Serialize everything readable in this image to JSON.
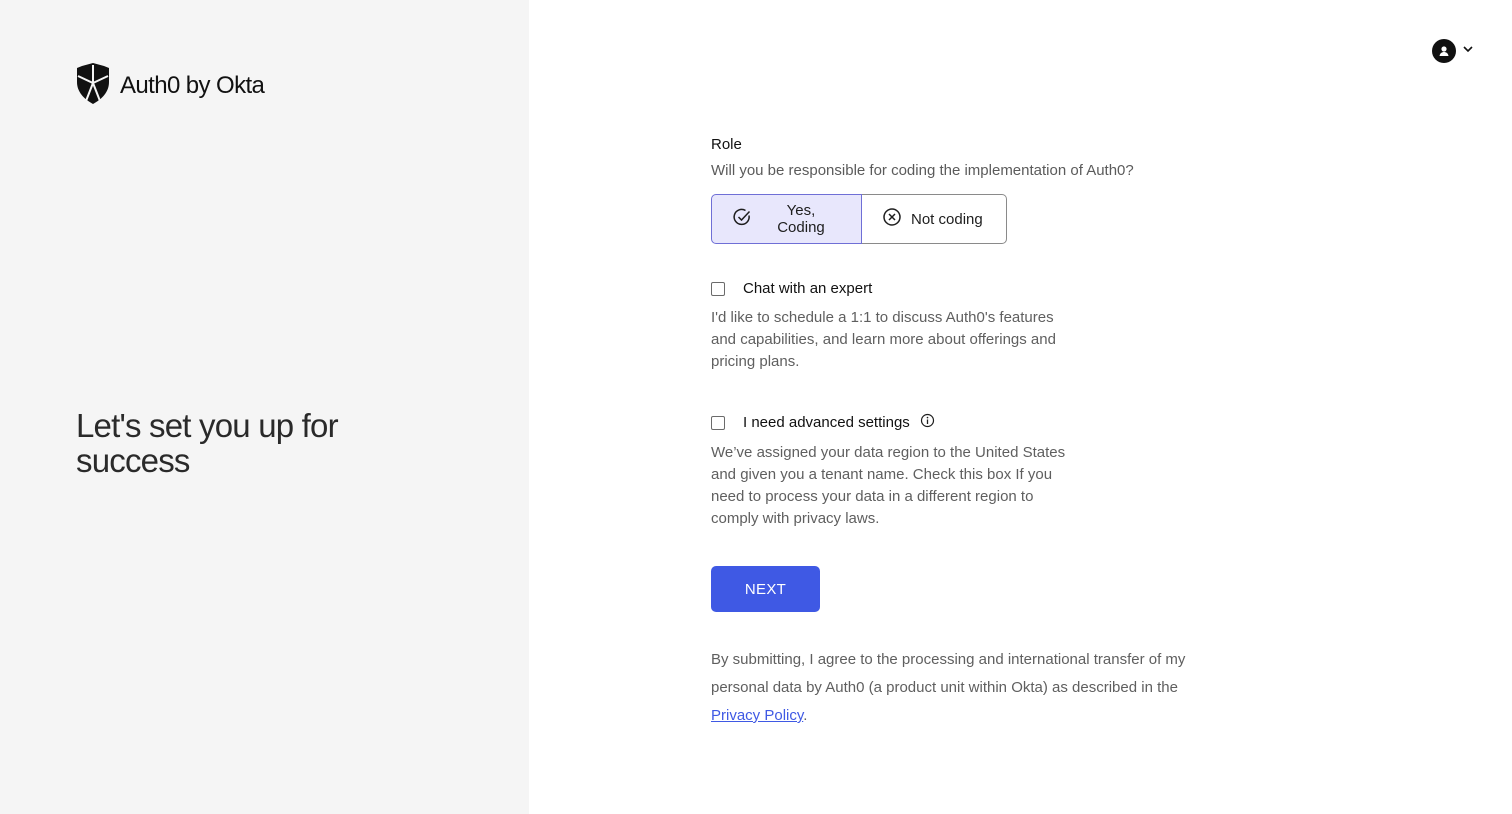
{
  "brand": {
    "name": "Auth0 by Okta",
    "logo_icon": "auth0-shield-icon"
  },
  "hero": {
    "title": "Let's set you up for success"
  },
  "user_menu": {
    "avatar_icon": "user-avatar-icon",
    "chevron_icon": "chevron-down-icon"
  },
  "form": {
    "role_label": "Role",
    "role_question": "Will you be responsible for coding the implementation of Auth0?",
    "options": [
      {
        "label": "Yes, Coding",
        "icon": "check-circle-icon",
        "selected": true
      },
      {
        "label": "Not coding",
        "icon": "x-circle-icon",
        "selected": false
      }
    ],
    "chat_expert": {
      "label": "Chat with an expert",
      "checked": false,
      "description": "I'd like to schedule a 1:1 to discuss Auth0's features and capabilities, and learn more about offerings and pricing plans."
    },
    "advanced": {
      "label": "I need advanced settings",
      "checked": false,
      "info_icon": "info-icon",
      "description": "We’ve assigned your data region to the United States and given you a tenant name. Check this box If you need to process your data in a different region to comply with privacy laws."
    },
    "next_label": "NEXT",
    "legal_text": "By submitting, I agree to the processing and international transfer of my personal data by Auth0 (a product unit within Okta) as described in the ",
    "privacy_link": "Privacy Policy",
    "legal_end": "."
  },
  "colors": {
    "accent": "#3f59e4",
    "selected_bg": "#e8e7fc",
    "left_panel_bg": "#f5f5f5"
  }
}
